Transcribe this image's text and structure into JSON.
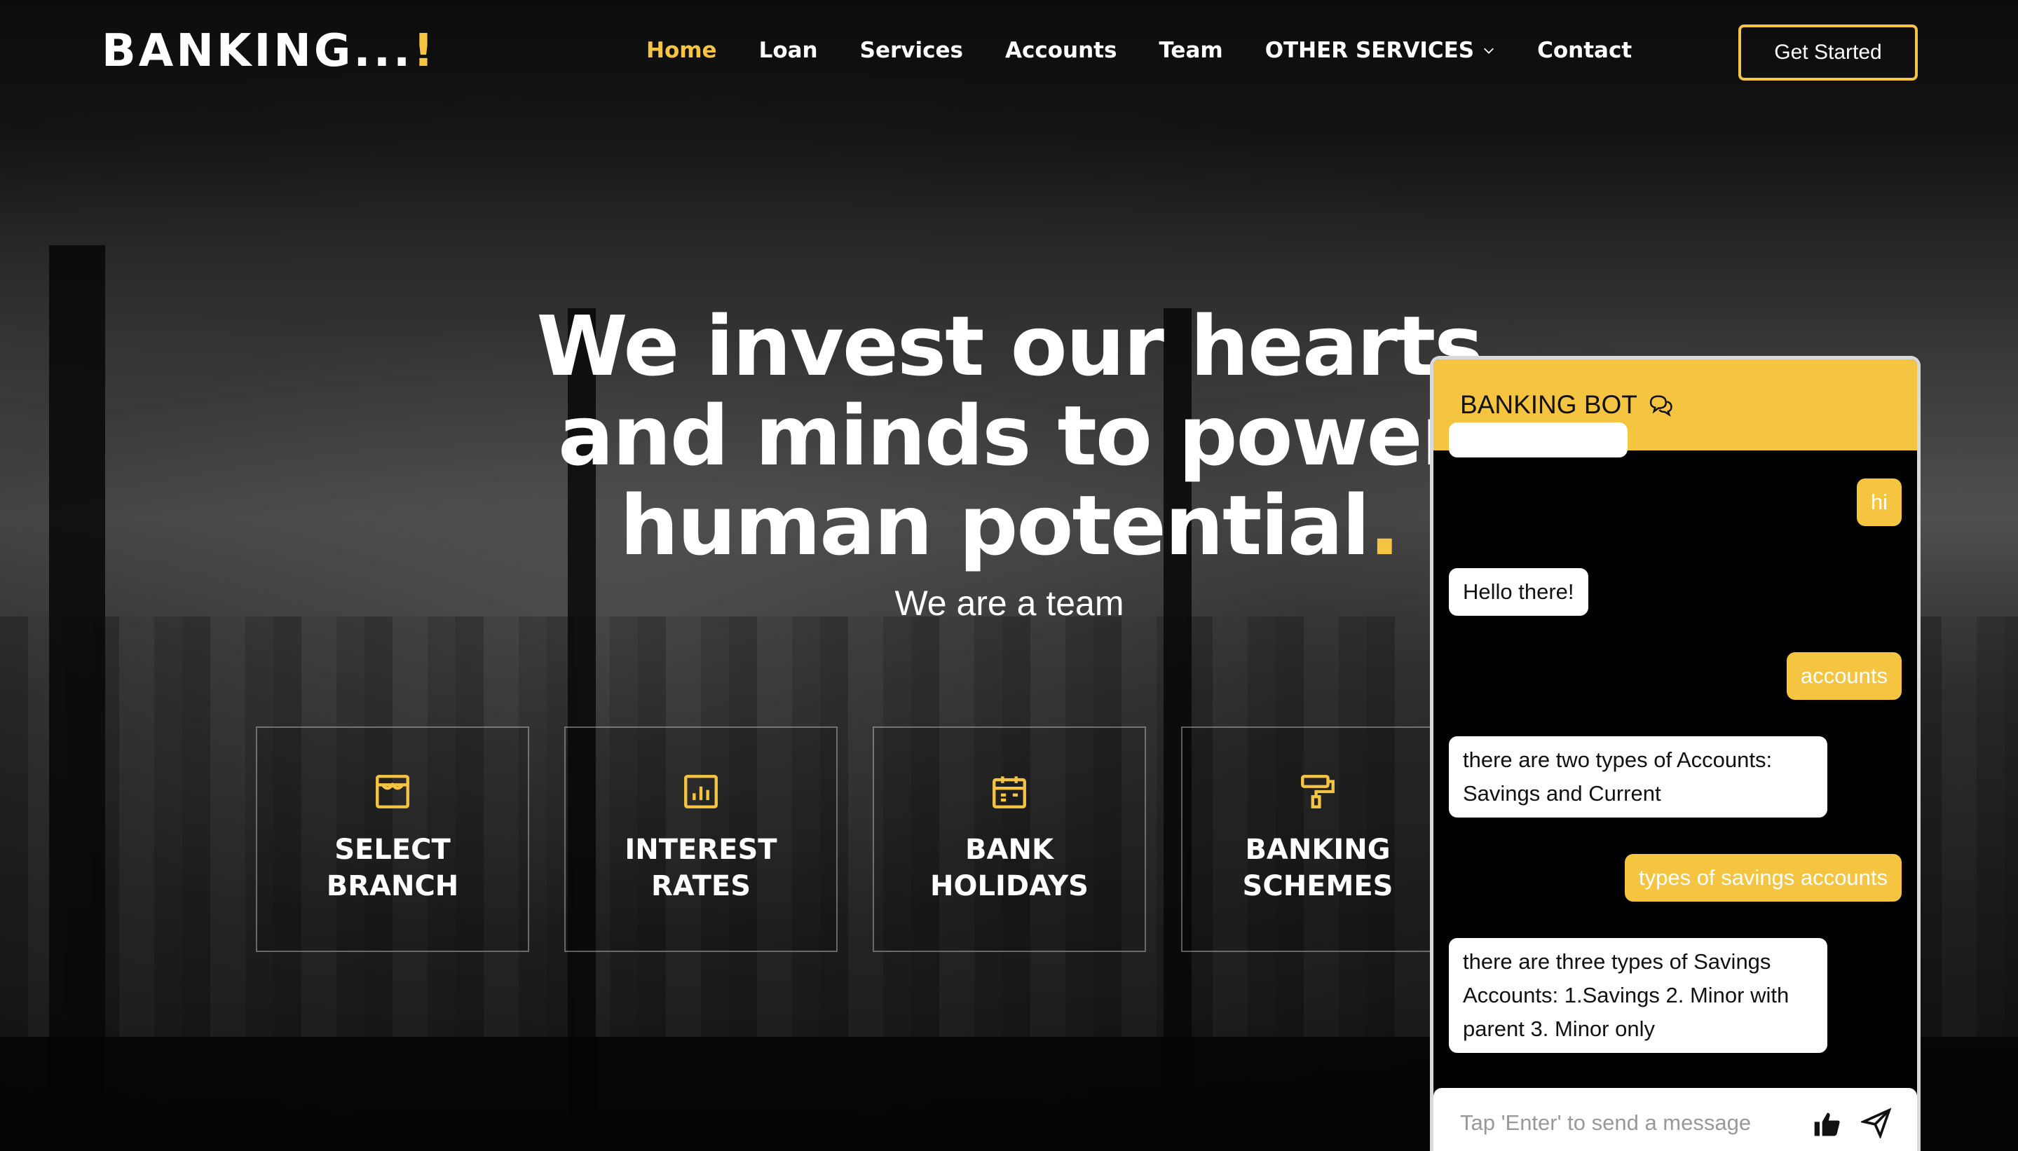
{
  "brand": {
    "name": "BANKING...",
    "accent": "!"
  },
  "nav": {
    "items": [
      {
        "label": "Home",
        "active": true
      },
      {
        "label": "Loan"
      },
      {
        "label": "Services"
      },
      {
        "label": "Accounts"
      },
      {
        "label": "Team"
      },
      {
        "label": "OTHER SERVICES"
      },
      {
        "label": "Contact"
      }
    ],
    "cta_label": "Get Started"
  },
  "hero": {
    "title_line1": "We invest our hearts",
    "title_line2": "and minds to power",
    "title_line3": "human potential",
    "title_dot": ".",
    "subtitle": "We are a team"
  },
  "features": [
    {
      "icon": "store-icon",
      "label": "SELECT\nBRANCH"
    },
    {
      "icon": "bar-chart-icon",
      "label": "INTEREST\nRATES"
    },
    {
      "icon": "calendar-icon",
      "label": "BANK\nHOLIDAYS"
    },
    {
      "icon": "paint-roller-icon",
      "label": "BANKING\nSCHEMES"
    }
  ],
  "chat": {
    "title": "BANKING BOT",
    "messages": [
      {
        "from": "user",
        "text": "hi"
      },
      {
        "from": "bot",
        "text": "Hello there!"
      },
      {
        "from": "user",
        "text": "accounts"
      },
      {
        "from": "bot",
        "text": "there are two types of Accounts: Savings and Current"
      },
      {
        "from": "user",
        "text": "types of savings accounts"
      },
      {
        "from": "bot",
        "text": "there are three types of Savings Accounts: 1.Savings 2. Minor with parent 3. Minor only"
      }
    ],
    "input_placeholder": "Tap 'Enter' to send a message"
  },
  "colors": {
    "accent": "#f5c542",
    "background": "#0d0d0d"
  }
}
